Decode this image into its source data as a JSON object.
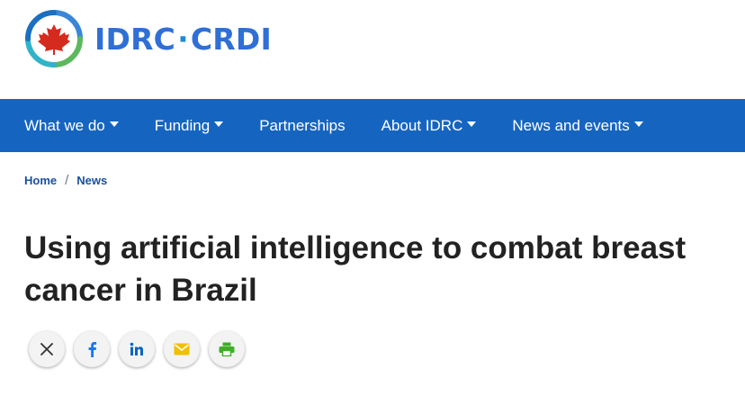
{
  "logo": {
    "left_text": "IDRC",
    "separator": "·",
    "right_text": "CRDI",
    "alt": "IDRC · CRDI"
  },
  "nav": {
    "items": [
      {
        "label": "What we do",
        "dropdown": true
      },
      {
        "label": "Funding",
        "dropdown": true
      },
      {
        "label": "Partnerships",
        "dropdown": false
      },
      {
        "label": "About IDRC",
        "dropdown": true
      },
      {
        "label": "News and events",
        "dropdown": true
      }
    ]
  },
  "breadcrumb": {
    "home": "Home",
    "separator": "/",
    "current": "News"
  },
  "article": {
    "title": "Using artificial intelligence to combat breast cancer in Brazil"
  },
  "share": {
    "buttons": [
      {
        "name": "x-twitter",
        "icon": "x-icon",
        "color": "#333333"
      },
      {
        "name": "facebook",
        "icon": "facebook-icon",
        "color": "#1877f2"
      },
      {
        "name": "linkedin",
        "icon": "linkedin-icon",
        "color": "#0a66c2"
      },
      {
        "name": "email",
        "icon": "email-icon",
        "color": "#f0c000"
      },
      {
        "name": "print",
        "icon": "print-icon",
        "color": "#3fae29"
      }
    ]
  },
  "colors": {
    "nav_bg": "#1565c0",
    "brand_blue": "#2f6fd6",
    "link": "#1a4f9c",
    "maple_red": "#d52b1e"
  }
}
